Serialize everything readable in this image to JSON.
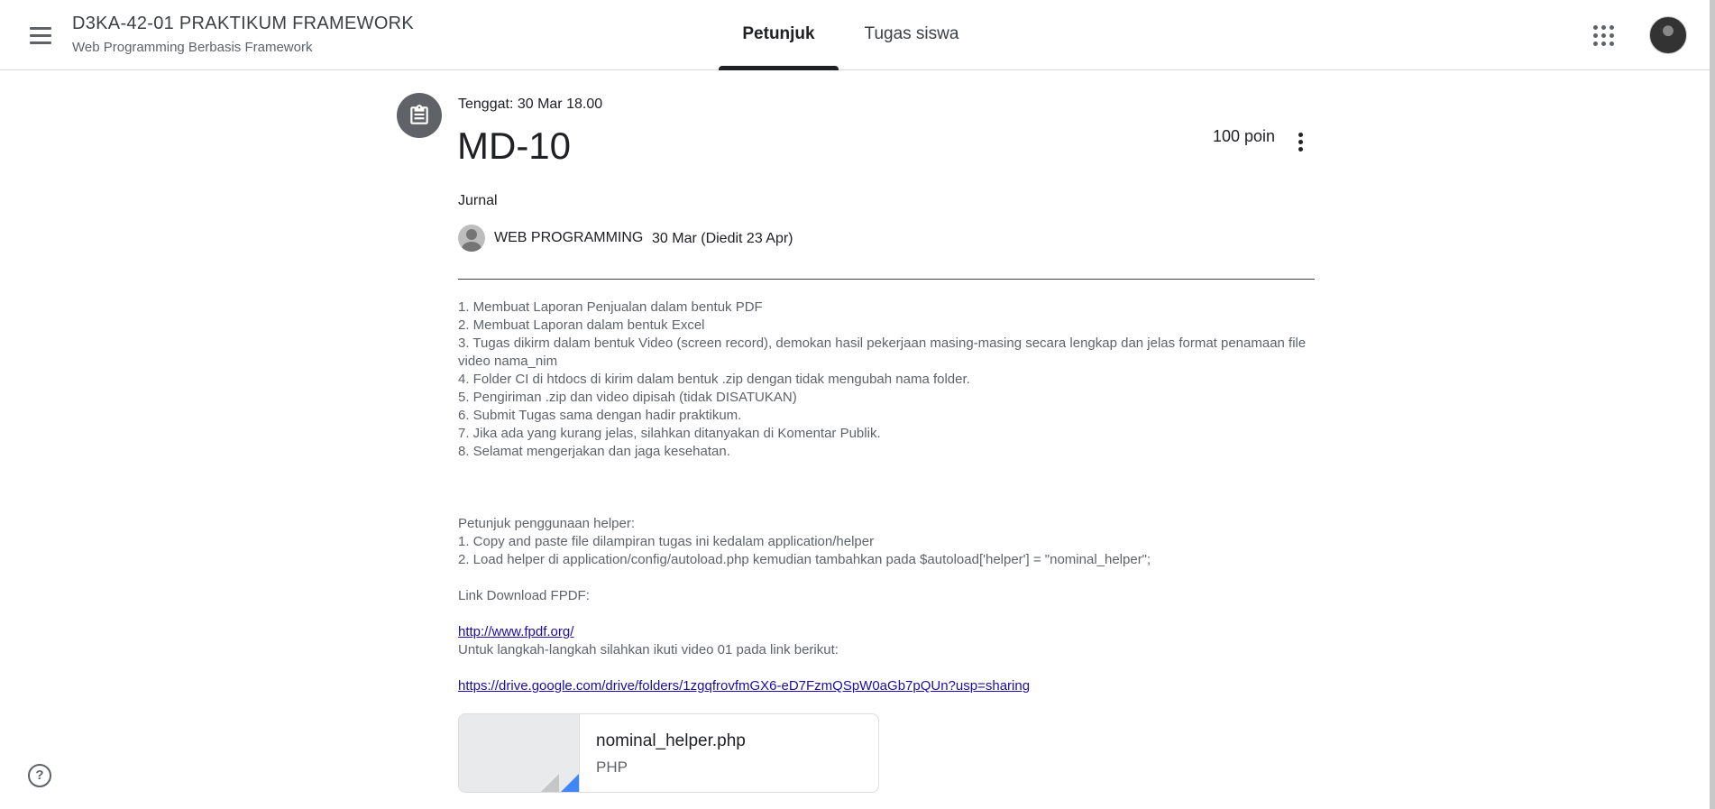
{
  "header": {
    "class_title": "D3KA-42-01 PRAKTIKUM FRAMEWORK",
    "class_subtitle": "Web Programming Berbasis Framework",
    "tabs": [
      {
        "label": "Petunjuk",
        "active": true
      },
      {
        "label": "Tugas siswa",
        "active": false
      }
    ]
  },
  "assignment": {
    "due": "Tenggat: 30 Mar 18.00",
    "title": "MD-10",
    "points": "100 poin",
    "topic": "Jurnal",
    "author": "WEB PROGRAMMING",
    "date": "30 Mar (Diedit 23 Apr)",
    "lines": [
      "1. Membuat Laporan Penjualan dalam bentuk PDF",
      "2. Membuat Laporan dalam bentuk Excel",
      "3. Tugas dikirm dalam bentuk Video (screen record), demokan hasil pekerjaan masing-masing secara lengkap dan jelas format penamaan file video nama_nim",
      "4. Folder CI di htdocs di kirim dalam bentuk .zip dengan tidak mengubah nama folder.",
      "5. Pengiriman .zip dan video dipisah (tidak DISATUKAN)",
      "6. Submit Tugas sama dengan hadir praktikum.",
      "7. Jika ada yang kurang jelas, silahkan ditanyakan di Komentar Publik.",
      "8. Selamat mengerjakan dan jaga kesehatan."
    ],
    "helper_heading": "Petunjuk penggunaan helper:",
    "helper_lines": [
      "1. Copy and paste file dilampiran tugas ini kedalam application/helper",
      "2. Load helper di application/config/autoload.php kemudian tambahkan pada $autoload['helper'] = \"nominal_helper\";"
    ],
    "fpdf_heading": "Link Download FPDF:",
    "fpdf_link": "http://www.fpdf.org/",
    "video_note": "Untuk langkah-langkah silahkan ikuti video 01 pada link berikut:",
    "drive_link": "https://drive.google.com/drive/folders/1zgqfrovfmGX6-eD7FzmQSpW0aGb7pQUn?usp=sharing",
    "attachment": {
      "name": "nominal_helper.php",
      "type": "PHP"
    }
  },
  "icons": {
    "menu": "menu-icon",
    "apps": "apps-grid-icon",
    "assignment": "assignment-clipboard-icon",
    "more": "more-vert-icon",
    "help": "help-icon"
  },
  "colors": {
    "accent": "#202124",
    "link": "#1a0dab",
    "icon_bg": "#5f6368"
  }
}
